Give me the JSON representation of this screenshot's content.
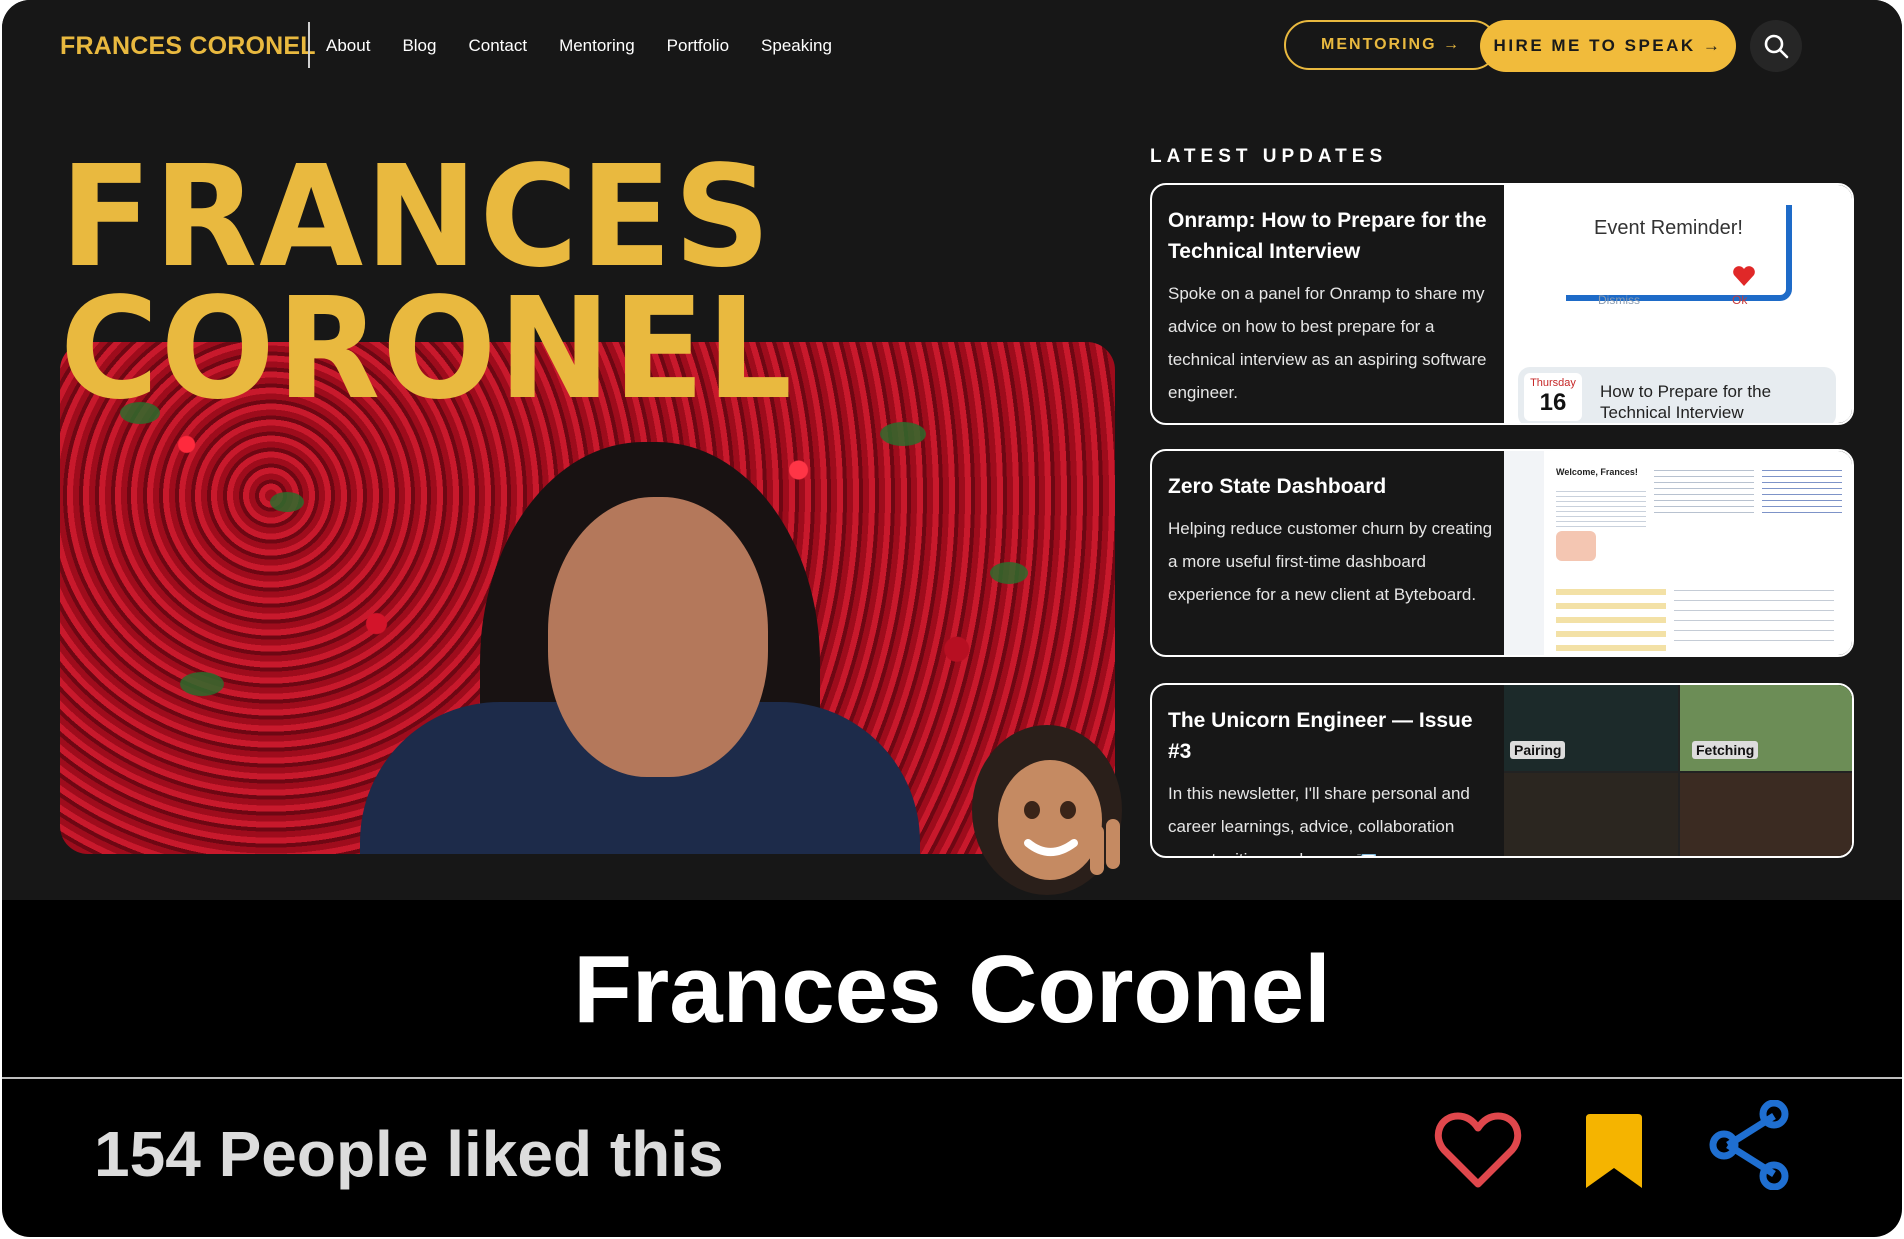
{
  "header": {
    "brand": "FRANCES CORONEL",
    "nav": [
      "About",
      "Blog",
      "Contact",
      "Mentoring",
      "Portfolio",
      "Speaking"
    ],
    "mentoring_button": "MENTORING →",
    "hire_button": "HIRE ME TO SPEAK →",
    "search_icon": "search-icon"
  },
  "hero": {
    "line1": "FRANCES",
    "line2": "CORONEL"
  },
  "updates": {
    "heading": "LATEST UPDATES",
    "items": [
      {
        "title": "Onramp: How to Prepare for the Technical Interview",
        "description": "Spoke on a panel for Onramp to share my advice on how to best prepare for a technical interview as an aspiring software engineer.",
        "thumb": {
          "reminder": "Event Reminder!",
          "dismiss": "Dismiss",
          "ok": "Ok",
          "day": "Thursday",
          "date": "16",
          "event": "How to Prepare for the Technical Interview"
        }
      },
      {
        "title": "Zero State Dashboard",
        "description": "Helping reduce customer churn by creating a more useful first-time dashboard experience for a new client at Byteboard.",
        "thumb": {
          "welcome": "Welcome, Frances!"
        }
      },
      {
        "title": "The Unicorn Engineer — Issue #3",
        "description": "In this newsletter, I'll share personal and career learnings, advice, collaboration opportunities, and more. 📨",
        "thumb": {
          "pairing": "Pairing",
          "fetching": "Fetching"
        }
      }
    ]
  },
  "footer": {
    "title": "Frances Coronel",
    "likes": "154 People liked this"
  },
  "colors": {
    "accent": "#e9b93f",
    "heart": "#e0474c",
    "bookmark": "#f5b400",
    "share": "#1f6fd1"
  }
}
